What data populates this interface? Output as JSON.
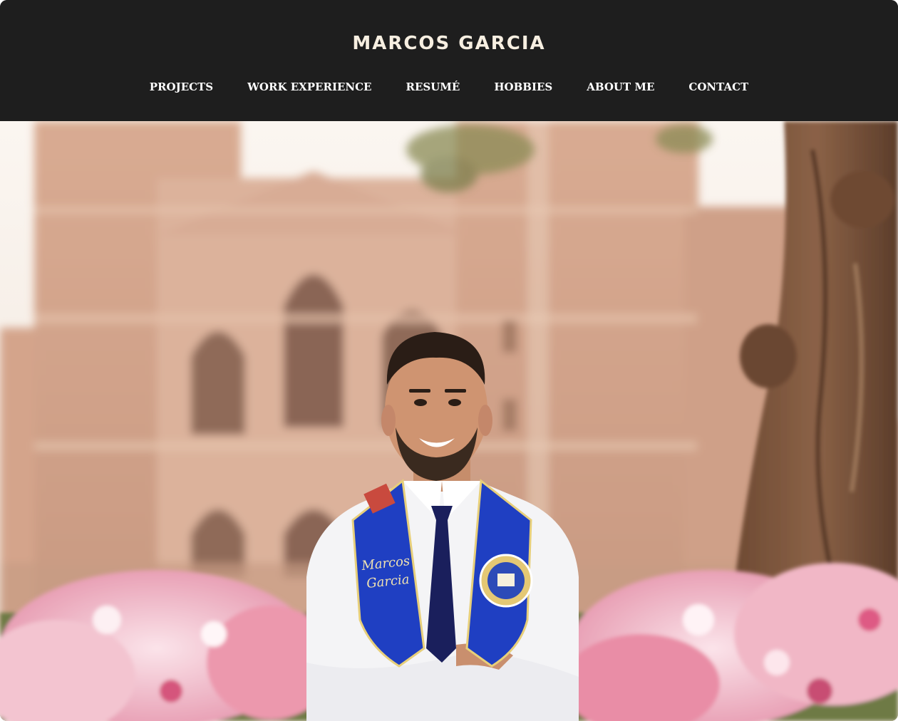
{
  "header": {
    "title": "MARCOS GARCIA",
    "nav": [
      {
        "label": "PROJECTS"
      },
      {
        "label": "WORK EXPERIENCE"
      },
      {
        "label": "RESUMÉ"
      },
      {
        "label": "HOBBIES"
      },
      {
        "label": "ABOUT ME"
      },
      {
        "label": "CONTACT"
      }
    ]
  },
  "hero": {
    "stole_text_line1": "Marcos",
    "stole_text_line2": "Garcia"
  },
  "colors": {
    "header_bg": "#1e1e1e",
    "title_color": "#f7efe1",
    "nav_color": "#ffffff",
    "stole_blue": "#1f3fc2",
    "tie_navy": "#1a1f5c"
  }
}
